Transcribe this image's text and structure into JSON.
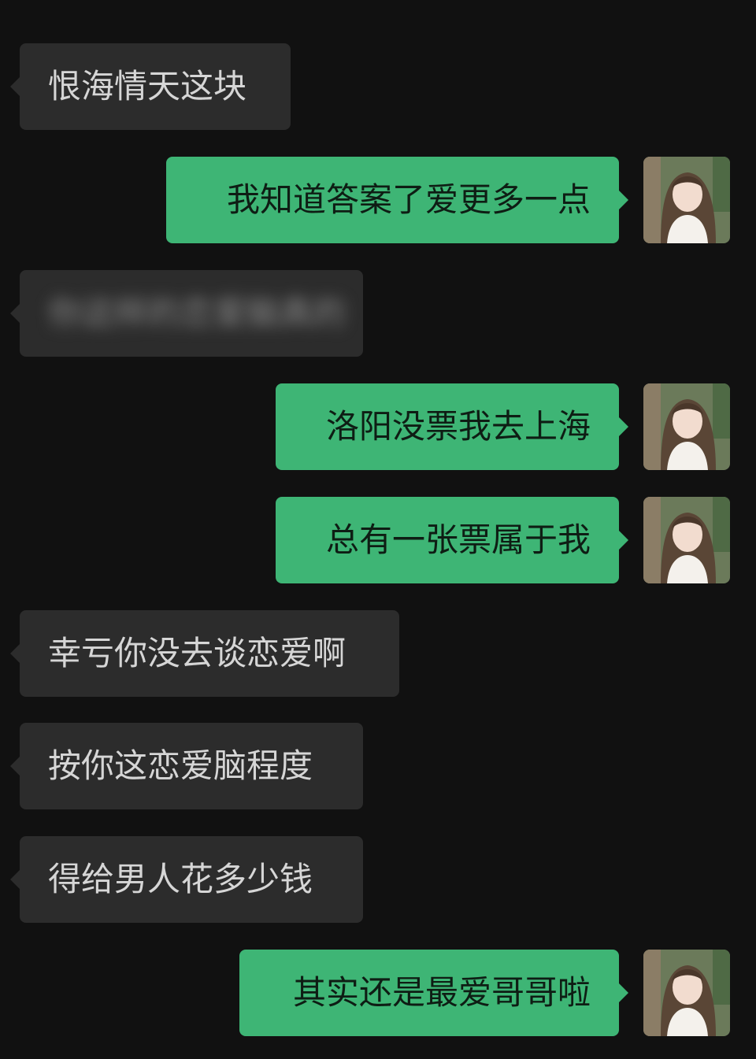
{
  "messages": [
    {
      "side": "in",
      "text": "恨海情天这块"
    },
    {
      "side": "out",
      "text": "我知道答案了爱更多一点"
    },
    {
      "side": "in",
      "text": "你这样的恋爱脑真的",
      "blurred": true
    },
    {
      "side": "out",
      "text": "洛阳没票我去上海"
    },
    {
      "side": "out",
      "text": "总有一张票属于我"
    },
    {
      "side": "in",
      "text": "幸亏你没去谈恋爱啊"
    },
    {
      "side": "in",
      "text": "按你这恋爱脑程度"
    },
    {
      "side": "in",
      "text": "得给男人花多少钱"
    },
    {
      "side": "out",
      "text": "其实还是最爱哥哥啦"
    }
  ],
  "avatar_icon": "user-photo-avatar",
  "colors": {
    "background": "#111111",
    "incoming_bubble": "#2c2c2c",
    "outgoing_bubble": "#3eb575",
    "incoming_text": "#d6d6d6",
    "outgoing_text": "#0e1d14"
  }
}
